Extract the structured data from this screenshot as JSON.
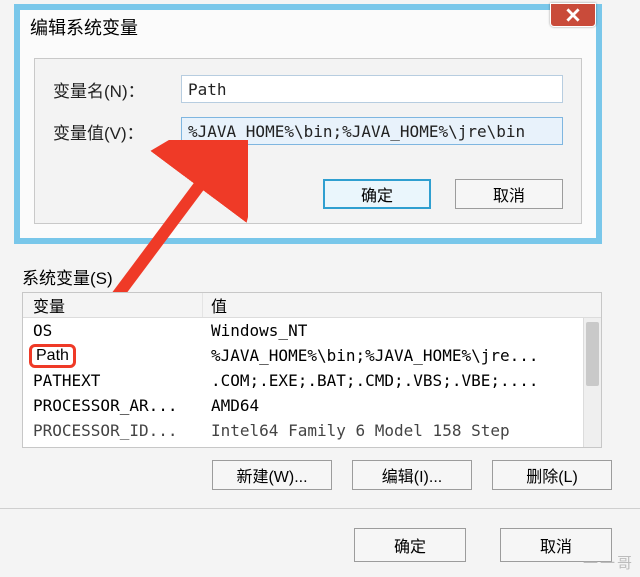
{
  "edit_dialog": {
    "title": "编辑系统变量",
    "name_label": "变量名(N)：",
    "name_value": "Path",
    "value_label": "变量值(V)：",
    "value_value": "%JAVA_HOME%\\bin;%JAVA_HOME%\\jre\\bin",
    "ok": "确定",
    "cancel": "取消"
  },
  "sysvars": {
    "label": "系统变量(S)",
    "col_var": "变量",
    "col_val": "值",
    "rows": [
      {
        "name": "OS",
        "value": "Windows_NT"
      },
      {
        "name": "Path",
        "value": "%JAVA_HOME%\\bin;%JAVA_HOME%\\jre..."
      },
      {
        "name": "PATHEXT",
        "value": ".COM;.EXE;.BAT;.CMD;.VBS;.VBE;...."
      },
      {
        "name": "PROCESSOR_AR...",
        "value": "AMD64"
      },
      {
        "name": "PROCESSOR_ID...",
        "value": "Intel64 Family 6 Model 158 Step"
      }
    ],
    "new": "新建(W)...",
    "edit": "编辑(I)...",
    "delete": "删除(L)"
  },
  "main": {
    "ok": "确定",
    "cancel": "取消"
  },
  "watermark": "一一哥"
}
